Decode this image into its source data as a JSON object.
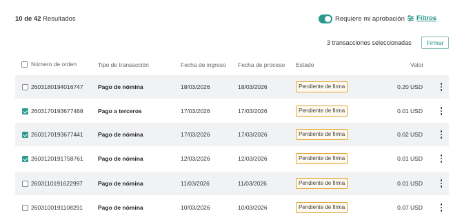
{
  "summary": {
    "count": "10 de 42",
    "label": "Resultados"
  },
  "approval": {
    "label": "Requiere mi aprobación",
    "enabled": true
  },
  "filters": {
    "label": "Filtros"
  },
  "selection": {
    "text": "3 transacciones seleccionadas",
    "sign_label": "Firmar"
  },
  "columns": {
    "order": "Número de orden",
    "type": "Tipo de transacción",
    "entry_date": "Fecha de ingreso",
    "process_date": "Fecha de proceso",
    "status": "Estado",
    "value": "Valor"
  },
  "rows": [
    {
      "checked": false,
      "order": "2603180194016747",
      "type": "Pago de nómina",
      "entry_date": "18/03/2026",
      "process_date": "18/03/2026",
      "status": "Pendiente de firma",
      "value": "0.20 USD"
    },
    {
      "checked": true,
      "order": "2603170193677468",
      "type": "Pago a terceros",
      "entry_date": "17/03/2026",
      "process_date": "17/03/2026",
      "status": "Pendiente de firma",
      "value": "0.01 USD"
    },
    {
      "checked": true,
      "order": "2603170193677441",
      "type": "Pago de nómina",
      "entry_date": "17/03/2026",
      "process_date": "17/03/2026",
      "status": "Pendiente de firma",
      "value": "0.02 USD"
    },
    {
      "checked": true,
      "order": "2603120191758761",
      "type": "Pago de nómina",
      "entry_date": "12/03/2026",
      "process_date": "12/03/2026",
      "status": "Pendiente de firma",
      "value": "0.01 USD"
    },
    {
      "checked": false,
      "order": "2603110191622997",
      "type": "Pago de nómina",
      "entry_date": "11/03/2026",
      "process_date": "11/03/2026",
      "status": "Pendiente de firma",
      "value": "0.01 USD"
    },
    {
      "checked": false,
      "order": "2603100191108291",
      "type": "Pago de nómina",
      "entry_date": "10/03/2026",
      "process_date": "10/03/2026",
      "status": "Pendiente de firma",
      "value": "0.07 USD"
    }
  ],
  "colors": {
    "accent": "#1b8c84",
    "toggle": "#2a9a8e",
    "badge_border": "#e0a32e",
    "row_shade": "#f1f2f4"
  }
}
